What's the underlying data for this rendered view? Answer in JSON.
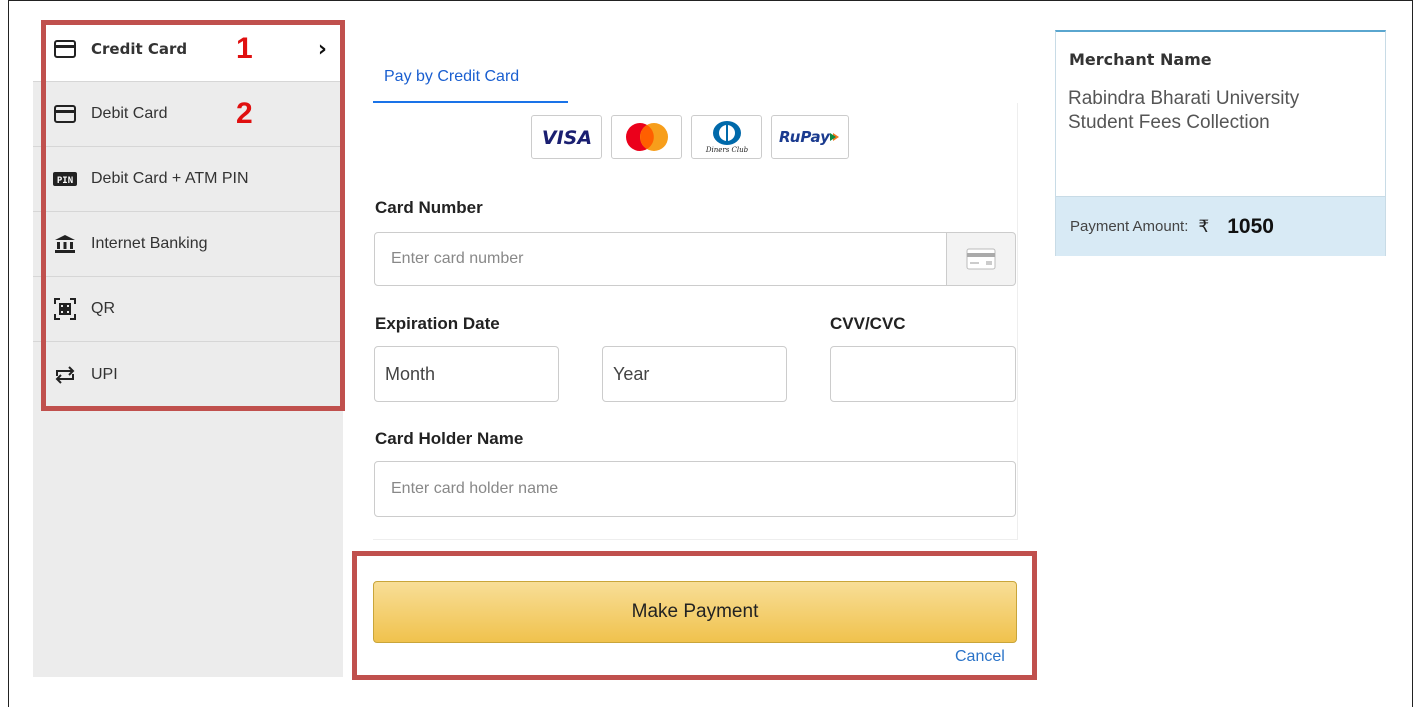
{
  "menu": {
    "items": [
      {
        "label": "Credit Card",
        "icon": "card-icon",
        "annotation": "1"
      },
      {
        "label": "Debit Card",
        "icon": "card-icon",
        "annotation": "2"
      },
      {
        "label": "Debit Card + ATM PIN",
        "icon": "pin-icon"
      },
      {
        "label": "Internet Banking",
        "icon": "bank-icon"
      },
      {
        "label": "QR",
        "icon": "qr-icon"
      },
      {
        "label": "UPI",
        "icon": "transfer-icon"
      }
    ]
  },
  "form": {
    "tab_label": "Pay by Credit Card",
    "brands": [
      "VISA",
      "Mastercard",
      "Diners Club",
      "RuPay"
    ],
    "card_number_label": "Card Number",
    "card_number_placeholder": "Enter card number",
    "expiration_label": "Expiration Date",
    "month_placeholder": "Month",
    "year_placeholder": "Year",
    "cvv_label": "CVV/CVC",
    "holder_label": "Card Holder Name",
    "holder_placeholder": "Enter card holder name",
    "pay_button": "Make Payment",
    "cancel_link": "Cancel"
  },
  "merchant": {
    "title": "Merchant Name",
    "name": "Rabindra Bharati University Student Fees Collection",
    "amount_label": "Payment Amount:",
    "currency": "₹",
    "amount": "1050"
  },
  "colors": {
    "annotation_red": "#e01010",
    "highlight_box": "#c0504d",
    "link_blue": "#1a5fd0",
    "button_gold": "#f0c24d"
  }
}
